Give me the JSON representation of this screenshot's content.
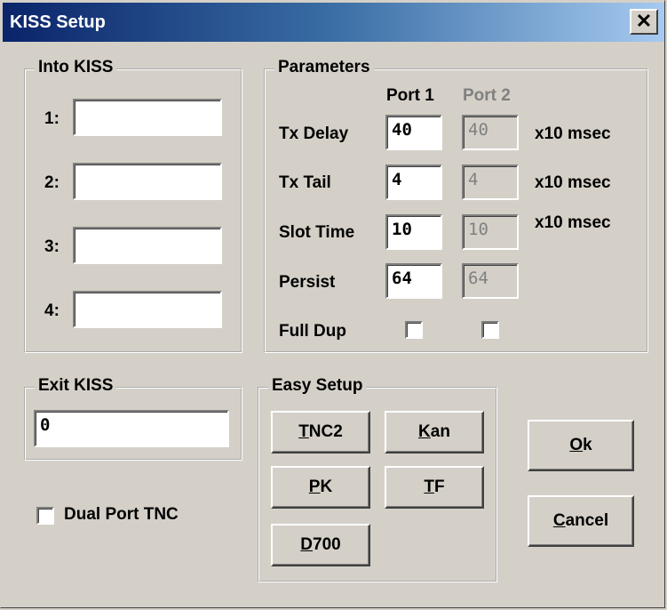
{
  "window": {
    "title": "KISS Setup",
    "close_glyph": "✕"
  },
  "into_kiss": {
    "legend": "Into KISS",
    "rows": [
      {
        "label": "1:",
        "value": ""
      },
      {
        "label": "2:",
        "value": ""
      },
      {
        "label": "3:",
        "value": ""
      },
      {
        "label": "4:",
        "value": ""
      }
    ]
  },
  "parameters": {
    "legend": "Parameters",
    "port1_header": "Port 1",
    "port2_header": "Port 2",
    "rows": [
      {
        "label": "Tx Delay",
        "port1": "40",
        "port2": "40",
        "unit": "x10 msec"
      },
      {
        "label": "Tx Tail",
        "port1": "4",
        "port2": "4",
        "unit": "x10 msec"
      },
      {
        "label": "Slot Time",
        "port1": "10",
        "port2": "10",
        "unit": "x10 msec"
      },
      {
        "label": "Persist",
        "port1": "64",
        "port2": "64",
        "unit": ""
      }
    ],
    "full_dup": {
      "label": "Full Dup",
      "port1_checked": false,
      "port2_checked": false
    }
  },
  "exit_kiss": {
    "legend": "Exit KISS",
    "value": "0"
  },
  "dual_port": {
    "label": "Dual Port TNC",
    "checked": false
  },
  "easy_setup": {
    "legend": "Easy Setup",
    "buttons": [
      {
        "mnemonic": "T",
        "rest": "NC2"
      },
      {
        "mnemonic": "K",
        "rest": "an",
        "pre": ""
      },
      {
        "mnemonic": "P",
        "rest": "K"
      },
      {
        "mnemonic": "T",
        "rest": "F"
      },
      {
        "mnemonic": "D",
        "rest": "700"
      }
    ]
  },
  "actions": {
    "ok": {
      "mnemonic": "O",
      "rest": "k"
    },
    "cancel": {
      "mnemonic": "C",
      "rest": "ancel"
    }
  }
}
